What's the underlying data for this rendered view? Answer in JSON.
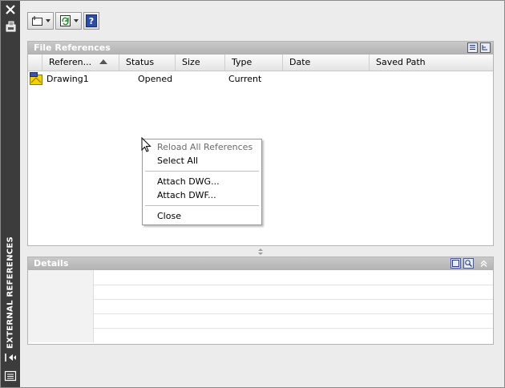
{
  "window": {
    "palette_title": "EXTERNAL REFERENCES"
  },
  "left_strip": {
    "icons": [
      "close-icon",
      "autohide-icon",
      "properties-icon",
      "menu-icon"
    ]
  },
  "toolbar": {
    "buttons": [
      {
        "icon": "attach-icon",
        "has_dropdown": true
      },
      {
        "icon": "refresh-icon",
        "has_dropdown": true
      },
      {
        "icon": "help-icon",
        "has_dropdown": false
      }
    ]
  },
  "file_references": {
    "title": "File References",
    "columns": [
      "Referen...",
      "Status",
      "Size",
      "Type",
      "Date",
      "Saved Path"
    ],
    "sort_column": "Referen...",
    "rows": [
      {
        "icon": "drawing-icon",
        "name": "Drawing1",
        "status": "Opened",
        "size": "",
        "type": "Current",
        "date": "",
        "saved_path": ""
      }
    ]
  },
  "context_menu": {
    "items": [
      {
        "label": "Reload All References",
        "disabled": true
      },
      {
        "label": "Select All",
        "disabled": false
      },
      {
        "separator": true
      },
      {
        "label": "Attach DWG...",
        "disabled": false
      },
      {
        "label": "Attach DWF...",
        "disabled": false
      },
      {
        "separator": true
      },
      {
        "label": "Close",
        "disabled": false
      }
    ]
  },
  "details": {
    "title": "Details",
    "rows": 5
  },
  "colors": {
    "strip": "#3c3c3c",
    "panel_header": "#b9b9b9",
    "frame_bg": "#ececec"
  }
}
